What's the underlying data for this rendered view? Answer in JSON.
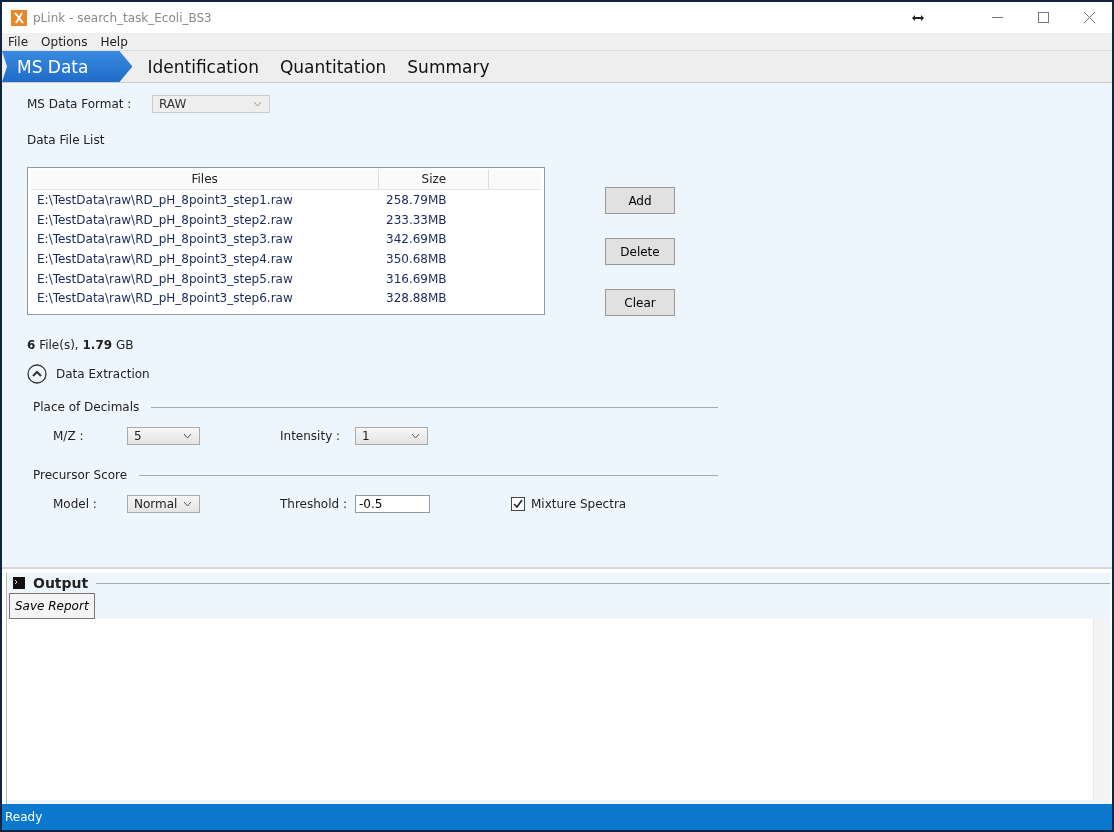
{
  "window": {
    "title": "pLink - search_task_Ecoli_BS3"
  },
  "menu": [
    "File",
    "Options",
    "Help"
  ],
  "tabs": [
    {
      "label": "MS Data",
      "selected": true
    },
    {
      "label": "Identification",
      "selected": false
    },
    {
      "label": "Quantitation",
      "selected": false
    },
    {
      "label": "Summary",
      "selected": false
    }
  ],
  "ms_data_format": {
    "label": "MS Data Format :",
    "value": "RAW",
    "disabled": true
  },
  "file_list": {
    "title": "Data File List",
    "columns": [
      "Files",
      "Size"
    ],
    "rows": [
      {
        "file": "E:\\TestData\\raw\\RD_pH_8point3_step1.raw",
        "size": "258.79MB"
      },
      {
        "file": "E:\\TestData\\raw\\RD_pH_8point3_step2.raw",
        "size": "233.33MB"
      },
      {
        "file": "E:\\TestData\\raw\\RD_pH_8point3_step3.raw",
        "size": "342.69MB"
      },
      {
        "file": "E:\\TestData\\raw\\RD_pH_8point3_step4.raw",
        "size": "350.68MB"
      },
      {
        "file": "E:\\TestData\\raw\\RD_pH_8point3_step5.raw",
        "size": "316.69MB"
      },
      {
        "file": "E:\\TestData\\raw\\RD_pH_8point3_step6.raw",
        "size": "328.88MB"
      }
    ],
    "buttons": [
      "Add",
      "Delete",
      "Clear"
    ],
    "summary": "**6** File(s), **1.79** GB"
  },
  "data_extraction": {
    "label": "Data Extraction",
    "expanded": true,
    "place_of_decimals": {
      "title": "Place of Decimals",
      "mz": {
        "label": "M/Z :",
        "value": "5"
      },
      "intensity": {
        "label": "Intensity :",
        "value": "1"
      }
    },
    "precursor_score": {
      "title": "Precursor Score",
      "model": {
        "label": "Model :",
        "value": "Normal"
      },
      "threshold": {
        "label": "Threshold :",
        "value": "-0.5"
      },
      "mixture_spectra": {
        "label": "Mixture Spectra",
        "checked": true
      }
    }
  },
  "output": {
    "title": "Output",
    "save_button": "Save Report"
  },
  "status_bar": "Ready"
}
